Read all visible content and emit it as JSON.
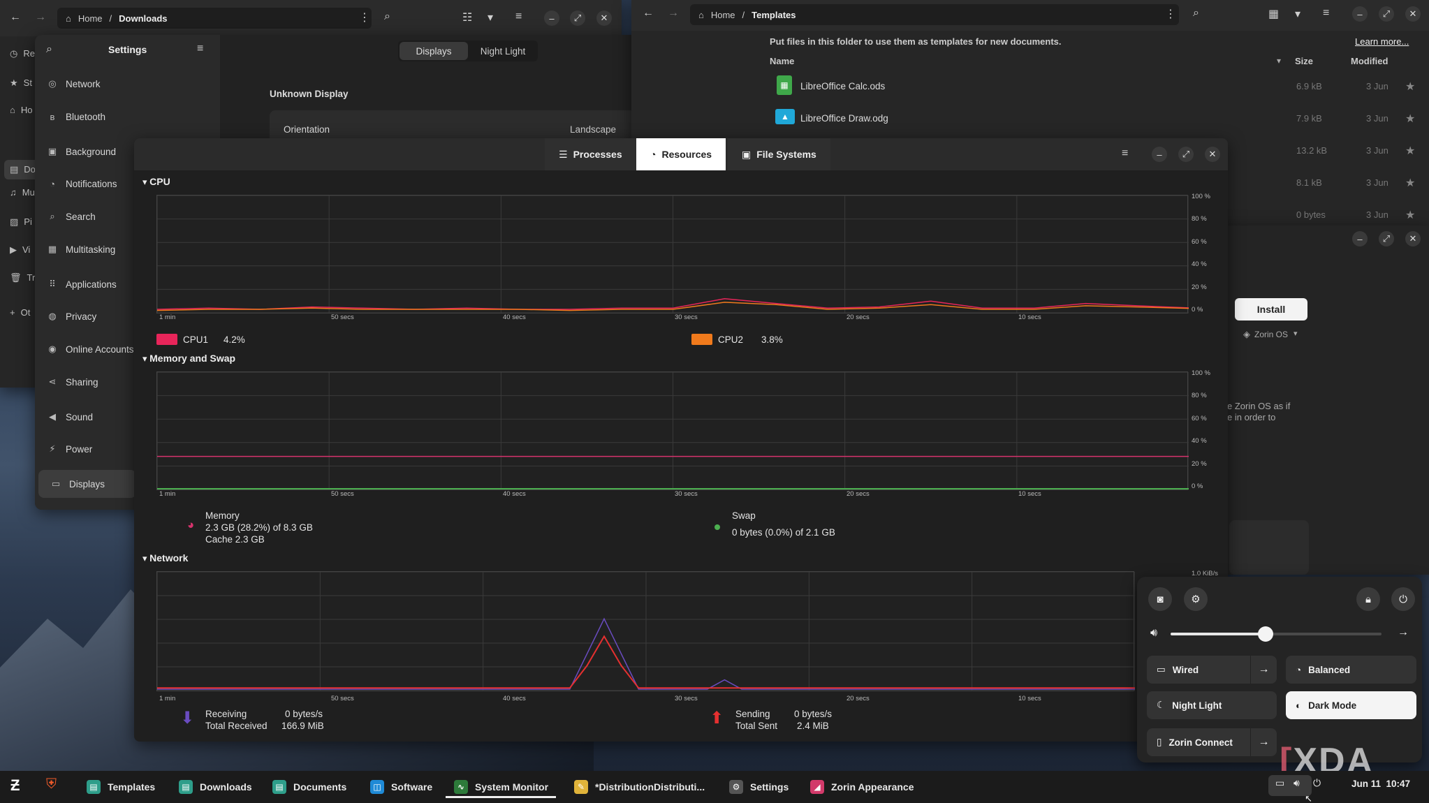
{
  "files_left": {
    "path_home": "Home",
    "path_current": "Downloads",
    "sidebar_initials": [
      "Re",
      "St",
      "Ho",
      "Do",
      "Mu",
      "Pi",
      "Vi",
      "Tr",
      "Ot"
    ]
  },
  "settings": {
    "title": "Settings",
    "items": [
      {
        "label": "Network",
        "icon": "◎"
      },
      {
        "label": "Bluetooth",
        "icon": "ʙ"
      },
      {
        "label": "Background",
        "icon": "▣"
      },
      {
        "label": "Notifications",
        "icon": "◔"
      },
      {
        "label": "Search",
        "icon": "⌕"
      },
      {
        "label": "Multitasking",
        "icon": "▦"
      },
      {
        "label": "Applications",
        "icon": "⠿"
      },
      {
        "label": "Privacy",
        "icon": "◍"
      },
      {
        "label": "Online Accounts",
        "icon": "◉"
      },
      {
        "label": "Sharing",
        "icon": "⋖"
      },
      {
        "label": "Sound",
        "icon": "◀"
      },
      {
        "label": "Power",
        "icon": "⚡"
      },
      {
        "label": "Displays",
        "icon": "▭"
      }
    ],
    "tab_displays": "Displays",
    "tab_night_light": "Night Light",
    "display_name": "Unknown Display",
    "orientation_label": "Orientation",
    "orientation_value": "Landscape"
  },
  "files_right": {
    "path_home": "Home",
    "path_current": "Templates",
    "info": "Put files in this folder to use them as templates for new documents.",
    "learn_more": "Learn more...",
    "columns": {
      "name": "Name",
      "size": "Size",
      "modified": "Modified"
    },
    "rows": [
      {
        "name": "LibreOffice Calc.ods",
        "size": "6.9 kB",
        "modified": "3 Jun"
      },
      {
        "name": "LibreOffice Draw.odg",
        "size": "7.9 kB",
        "modified": "3 Jun"
      },
      {
        "name": "",
        "size": "13.2 kB",
        "modified": "3 Jun"
      },
      {
        "name": "",
        "size": "8.1 kB",
        "modified": "3 Jun"
      },
      {
        "name": "",
        "size": "0 bytes",
        "modified": "3 Jun"
      }
    ]
  },
  "software": {
    "install": "Install",
    "source": "Zorin OS",
    "desc_line1": "e Zorin OS as if",
    "desc_line2": "e in order to"
  },
  "monitor": {
    "tabs": {
      "processes": "Processes",
      "resources": "Resources",
      "file_systems": "File Systems"
    },
    "cpu_title": "CPU",
    "mem_title": "Memory and Swap",
    "net_title": "Network",
    "y_ticks": [
      "100 %",
      "80 %",
      "60 %",
      "40 %",
      "20 %",
      "0 %"
    ],
    "x_ticks": [
      "1 min",
      "50 secs",
      "40 secs",
      "30 secs",
      "20 secs",
      "10 secs"
    ],
    "net_y_max": "1.0 KiB/s",
    "cpu1_label": "CPU1",
    "cpu1_value": "4.2%",
    "cpu2_label": "CPU2",
    "cpu2_value": "3.8%",
    "memory_label": "Memory",
    "memory_value": "2.3 GB (28.2%) of 8.3 GB",
    "cache": "Cache 2.3 GB",
    "swap_label": "Swap",
    "swap_value": "0 bytes (0.0%) of 2.1 GB",
    "receiving_label": "Receiving",
    "receiving_value": "0 bytes/s",
    "total_received_label": "Total Received",
    "total_received_value": "166.9 MiB",
    "sending_label": "Sending",
    "sending_value": "0 bytes/s",
    "total_sent_label": "Total Sent",
    "total_sent_value": "2.4 MiB"
  },
  "quick": {
    "volume": 0.45,
    "wired": "Wired",
    "balanced": "Balanced",
    "night_light": "Night Light",
    "dark_mode": "Dark Mode",
    "zorin_connect": "Zorin Connect"
  },
  "taskbar": {
    "items": [
      "Templates",
      "Downloads",
      "Documents",
      "Software",
      "System Monitor",
      "*DistributionDistributi...",
      "Settings",
      "Zorin Appearance"
    ],
    "clock": "Jun 11  10:47",
    "watermark": "XDA"
  },
  "colors": {
    "cpu1": "#e8255a",
    "cpu2": "#f07a1c",
    "memory": "#d6336c",
    "swap": "#4caf50",
    "receiving": "#6a4cc0",
    "sending": "#e53030"
  },
  "chart_data": {
    "type": "line",
    "x": [
      60,
      57,
      54,
      51,
      48,
      45,
      42,
      39,
      36,
      33,
      30,
      27,
      24,
      21,
      18,
      15,
      12,
      9,
      6,
      3,
      0
    ],
    "series": [
      {
        "name": "CPU1",
        "values": [
          3,
          4,
          3,
          5,
          4,
          3,
          4,
          3,
          3,
          4,
          4,
          12,
          8,
          4,
          5,
          10,
          4,
          4,
          8,
          6,
          4.2
        ]
      },
      {
        "name": "CPU2",
        "values": [
          2,
          3,
          3,
          4,
          3,
          3,
          3,
          3,
          2,
          3,
          3,
          9,
          7,
          3,
          4,
          7,
          3,
          3,
          6,
          5,
          3.8
        ]
      }
    ],
    "ylim": [
      0,
      100
    ]
  }
}
